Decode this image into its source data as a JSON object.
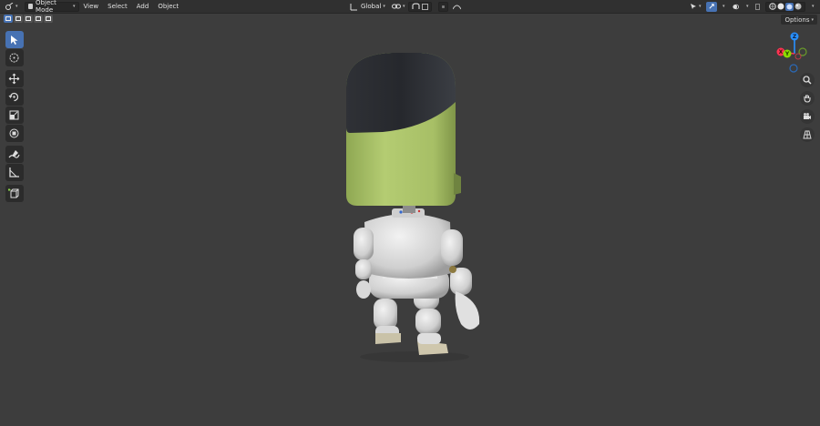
{
  "header": {
    "editor_type_icon": "3d-viewport-icon",
    "mode": "Object Mode",
    "menus": [
      "View",
      "Select",
      "Add",
      "Object"
    ],
    "transform_orientation": "Global"
  },
  "options_label": "Options",
  "gizmo": {
    "z": "Z",
    "y": "Y",
    "x": "X"
  },
  "toolbar": {
    "tools": [
      "select-box-icon",
      "cursor-icon",
      "move-icon",
      "rotate-icon",
      "scale-icon",
      "transform-icon",
      "annotate-icon",
      "measure-icon",
      "add-cube-icon"
    ]
  },
  "colors": {
    "accent": "#4772b3",
    "viewport_bg": "#3d3d3d",
    "header_bg": "#303030",
    "axis_x": "#ff3352",
    "axis_y": "#8bdc00",
    "axis_z": "#2890ff"
  }
}
